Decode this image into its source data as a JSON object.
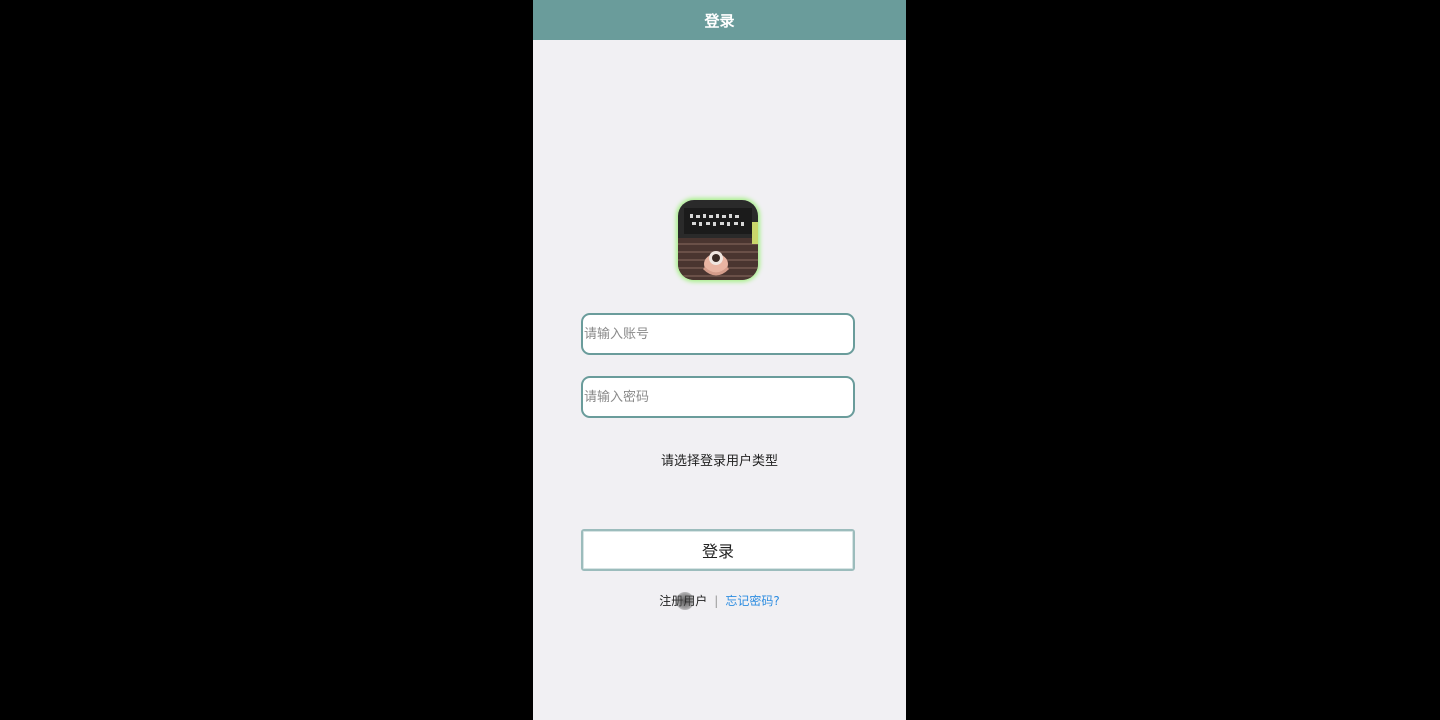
{
  "header": {
    "title": "登录",
    "color": "#6a9c9b"
  },
  "avatar": {
    "icon": "app-avatar-image"
  },
  "form": {
    "account_placeholder": "请输入账号",
    "password_placeholder": "请输入密码",
    "user_type_prompt": "请选择登录用户类型",
    "login_label": "登录"
  },
  "links": {
    "register_label": "注册用户",
    "separator": "|",
    "forgot_label": "忘记密码?",
    "forgot_color": "#2d8ce0"
  }
}
